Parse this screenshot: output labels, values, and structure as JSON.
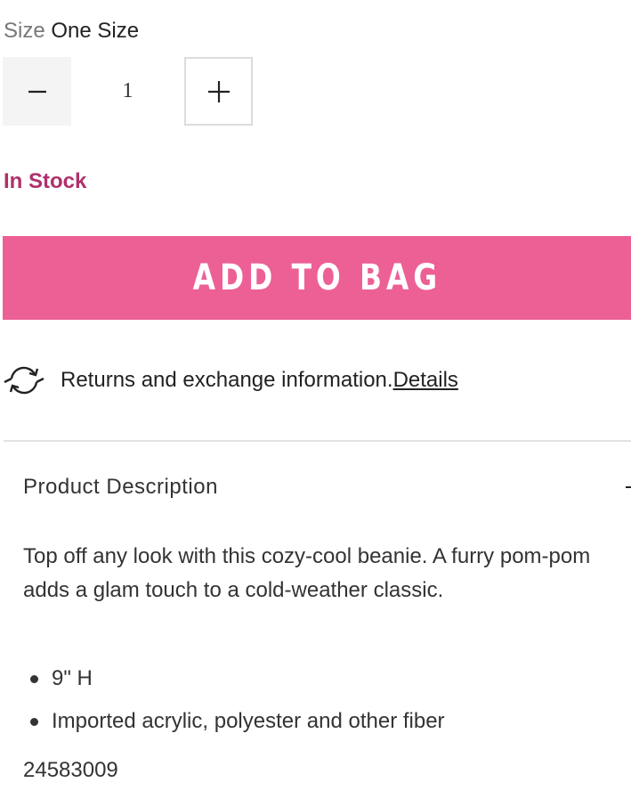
{
  "size": {
    "label": "Size",
    "value": "One Size"
  },
  "quantity": {
    "value": "1",
    "decrement_icon": "minus-icon",
    "increment_icon": "plus-icon"
  },
  "stock": {
    "status": "In Stock",
    "color": "#b0306b"
  },
  "add_to_bag": {
    "label": "ADD TO BAG",
    "color": "#ec6095"
  },
  "returns": {
    "icon": "refresh-arrows-icon",
    "text": "Returns and exchange information.",
    "link_label": "Details"
  },
  "description": {
    "header": "Product Description",
    "toggle_icon": "plus-icon",
    "text": "Top off any look with this cozy-cool beanie. A furry pom-pom adds a glam touch to a cold-weather classic.",
    "bullets": [
      "9\" H",
      "Imported acrylic, polyester and other fiber"
    ],
    "sku": "24583009"
  }
}
